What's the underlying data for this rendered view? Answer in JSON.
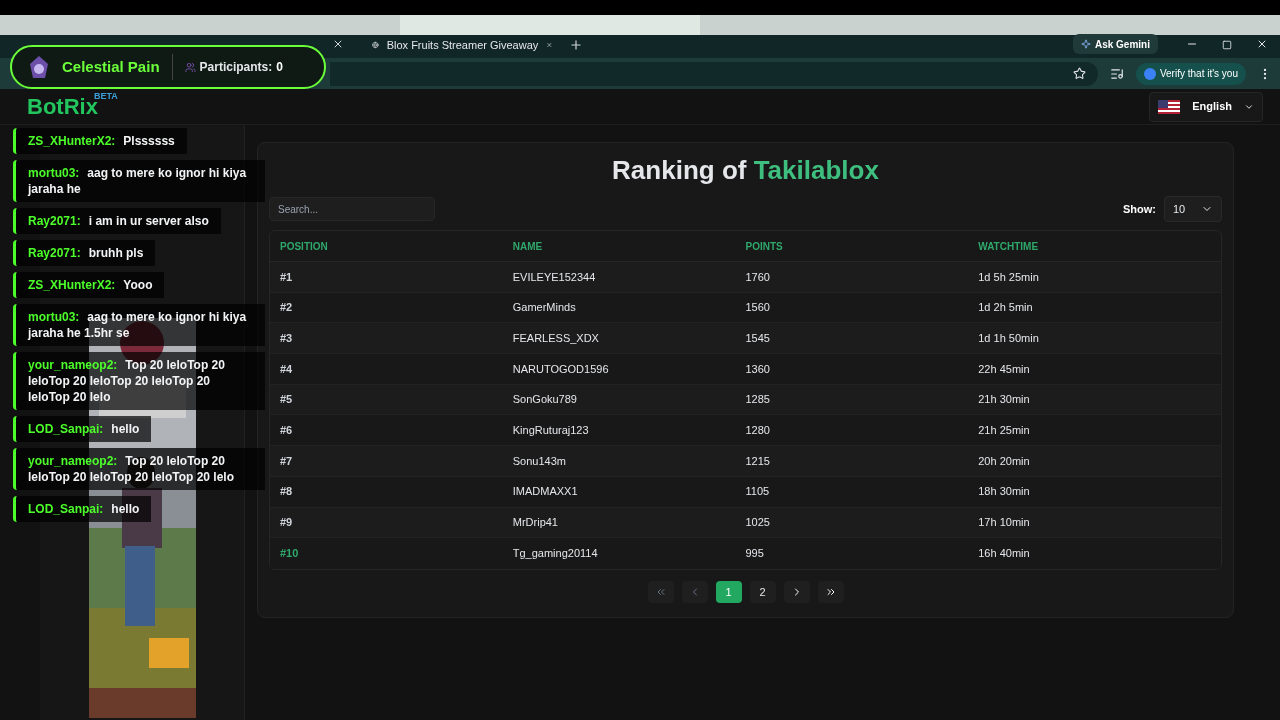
{
  "browser": {
    "tabs": [
      {
        "title": "Blox Fruits Streamer Giveaway",
        "selected": false
      }
    ],
    "ask_button": "Ask Gemini",
    "verify_button": "Verify that it's you"
  },
  "header": {
    "logo": "BotRix",
    "logo_badge": "BETA",
    "language": "English"
  },
  "ranking": {
    "title_prefix": "Ranking of",
    "title_name": "Takilablox",
    "search_placeholder": "Search...",
    "show_label": "Show:",
    "show_value": "10",
    "columns": [
      "POSITION",
      "NAME",
      "POINTS",
      "WATCHTIME"
    ],
    "rows": [
      {
        "position": "#1",
        "name": "EVILEYE152344",
        "points": "1760",
        "watchtime": "1d 5h 25min"
      },
      {
        "position": "#2",
        "name": "GamerMinds",
        "points": "1560",
        "watchtime": "1d 2h 5min"
      },
      {
        "position": "#3",
        "name": "FEARLESS_XDX",
        "points": "1545",
        "watchtime": "1d 1h 50min"
      },
      {
        "position": "#4",
        "name": "NARUTOGOD1596",
        "points": "1360",
        "watchtime": "22h 45min"
      },
      {
        "position": "#5",
        "name": "SonGoku789",
        "points": "1285",
        "watchtime": "21h 30min"
      },
      {
        "position": "#6",
        "name": "KingRuturaj123",
        "points": "1280",
        "watchtime": "21h 25min"
      },
      {
        "position": "#7",
        "name": "Sonu143m",
        "points": "1215",
        "watchtime": "20h 20min"
      },
      {
        "position": "#8",
        "name": "IMADMAXX1",
        "points": "1105",
        "watchtime": "18h 30min"
      },
      {
        "position": "#9",
        "name": "MrDrip41",
        "points": "1025",
        "watchtime": "17h 10min"
      },
      {
        "position": "#10",
        "name": "Tg_gaming20114",
        "points": "995",
        "watchtime": "16h 40min"
      }
    ],
    "pages": [
      {
        "label": "1",
        "selected": true
      },
      {
        "label": "2",
        "selected": false
      }
    ]
  },
  "overlay": {
    "giveaway_title": "Celestial Pain",
    "participants_label": "Participants:",
    "participants_count": "0",
    "chat": [
      {
        "user": "ZS_XHunterX2:",
        "text": "Plssssss"
      },
      {
        "user": "mortu03:",
        "text": "aag to mere ko ignor hi kiya jaraha he"
      },
      {
        "user": "Ray2071:",
        "text": "i am in ur server also"
      },
      {
        "user": "Ray2071:",
        "text": "bruhh pls"
      },
      {
        "user": "ZS_XHunterX2:",
        "text": "Yooo"
      },
      {
        "user": "mortu03:",
        "text": "aag to mere ko ignor hi kiya jaraha he 1.5hr se"
      },
      {
        "user": "your_nameop2:",
        "text": "Top 20 leloTop 20 leloTop 20 leloTop 20 leloTop 20 leloTop 20 lelo"
      },
      {
        "user": "LOD_Sanpai:",
        "text": "hello"
      },
      {
        "user": "your_nameop2:",
        "text": "Top 20 leloTop 20 leloTop 20 leloTop 20 leloTop 20 lelo"
      },
      {
        "user": "LOD_Sanpai:",
        "text": "hello"
      }
    ]
  }
}
